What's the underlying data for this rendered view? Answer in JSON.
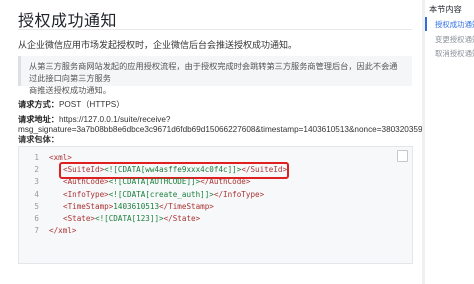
{
  "page": {
    "title": "授权成功通知",
    "intro": "从企业微信应用市场发起授权时，企业微信后台会推送授权成功通知。",
    "note_line1": "从第三方服务商网站发起的应用授权流程，由于授权完成时会跳转第三方服务商管理后台，因此不会通过此接口向第三方服务",
    "note_line2": "商推送授权成功通知。",
    "request_method_label": "请求方式：",
    "request_method_value": "POST（HTTPS）",
    "request_url_label": "请求地址：",
    "request_url_value": "https://127.0.0.1/suite/receive?",
    "request_url_params": "msg_signature=3a7b08bb8e6dbce3c9671d6fdb69d15066227608&timestamp=1403610513&nonce=380320359",
    "request_body_label": "请求包体："
  },
  "code": {
    "line_numbers": [
      "1",
      "2",
      "3",
      "4",
      "5",
      "6",
      "7"
    ],
    "lines": [
      {
        "open": "<xml>",
        "value": "",
        "close": ""
      },
      {
        "open": "<SuiteId>",
        "value": "<![CDATA[ww4asffe9xxx4c0f4c]]>",
        "close": "</SuiteId>"
      },
      {
        "open": "<AuthCode>",
        "value": "<![CDATA[AUTHCODE]]>",
        "close": "</AuthCode>"
      },
      {
        "open": "<InfoType>",
        "value": "<![CDATA[create_auth]]>",
        "close": "</InfoType>"
      },
      {
        "open": "<TimeStamp>",
        "value": "1403610513",
        "close": "</TimeStamp>"
      },
      {
        "open": "<State>",
        "value": "<![CDATA[123]]>",
        "close": "</State>"
      },
      {
        "open": "</xml>",
        "value": "",
        "close": ""
      }
    ]
  },
  "toc": {
    "title": "本节内容",
    "items": [
      "授权成功通知",
      "变更授权通知",
      "取消授权通知"
    ]
  }
}
